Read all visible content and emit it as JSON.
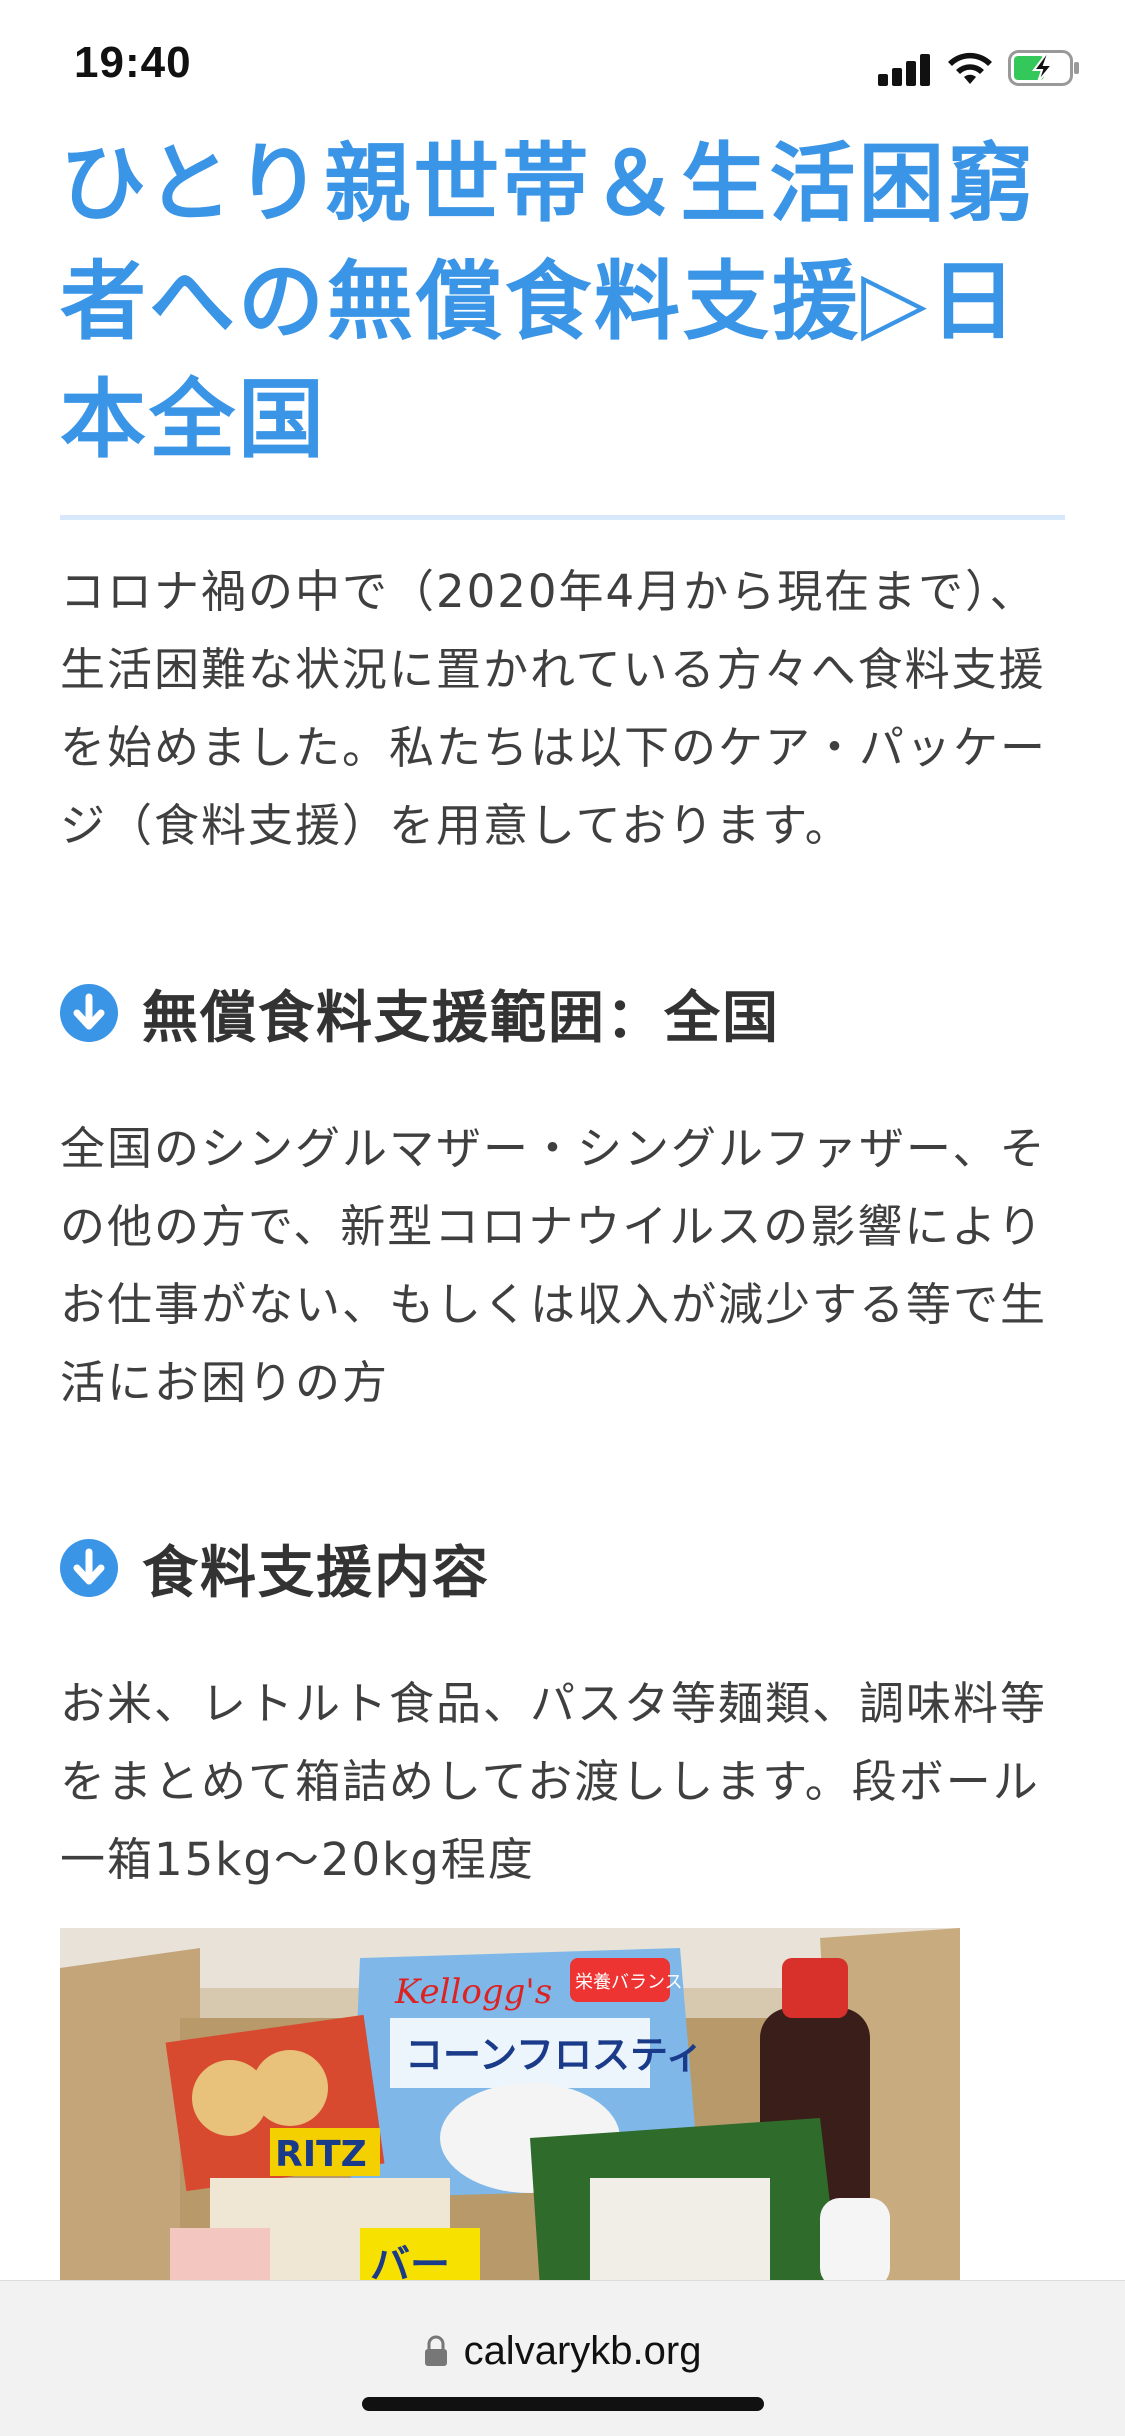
{
  "status_bar": {
    "time": "19:40"
  },
  "article": {
    "title": "ひとり親世帯＆生活困窮者への無償食料支援▷日本全国",
    "intro": "コロナ禍の中で（2020年4月から現在まで）、生活困難な状況に置かれている方々へ食料支援を始めました。私たちは以下のケア・パッケージ（食料支援）を用意しております。",
    "sections": [
      {
        "heading": "無償食料支援範囲：全国",
        "body": "全国のシングルマザー・シングルファザー、その他の方で、新型コロナウイルスの影響によりお仕事がない、もしくは収入が減少する等で生活にお困りの方"
      },
      {
        "heading": "食料支援内容",
        "body": "お米、レトルト食品、パスタ等麺類、調味料等をまとめて箱詰めしてお渡しします。段ボール一箱15kg～20kg程度"
      }
    ],
    "photo_labels": {
      "cracker": "RITZ",
      "cereal_brand": "Kellogg's",
      "cereal_name": "コーンフロスティ",
      "cereal_badge": "栄養バランス",
      "noodle_box": "バー"
    }
  },
  "browser": {
    "url": "calvarykb.org"
  },
  "colors": {
    "title_blue": "#3a95e7",
    "icon_blue": "#3a95e7",
    "body_text": "#3f3f3f",
    "rule": "#d6e8fa",
    "battery_green": "#34c759"
  }
}
